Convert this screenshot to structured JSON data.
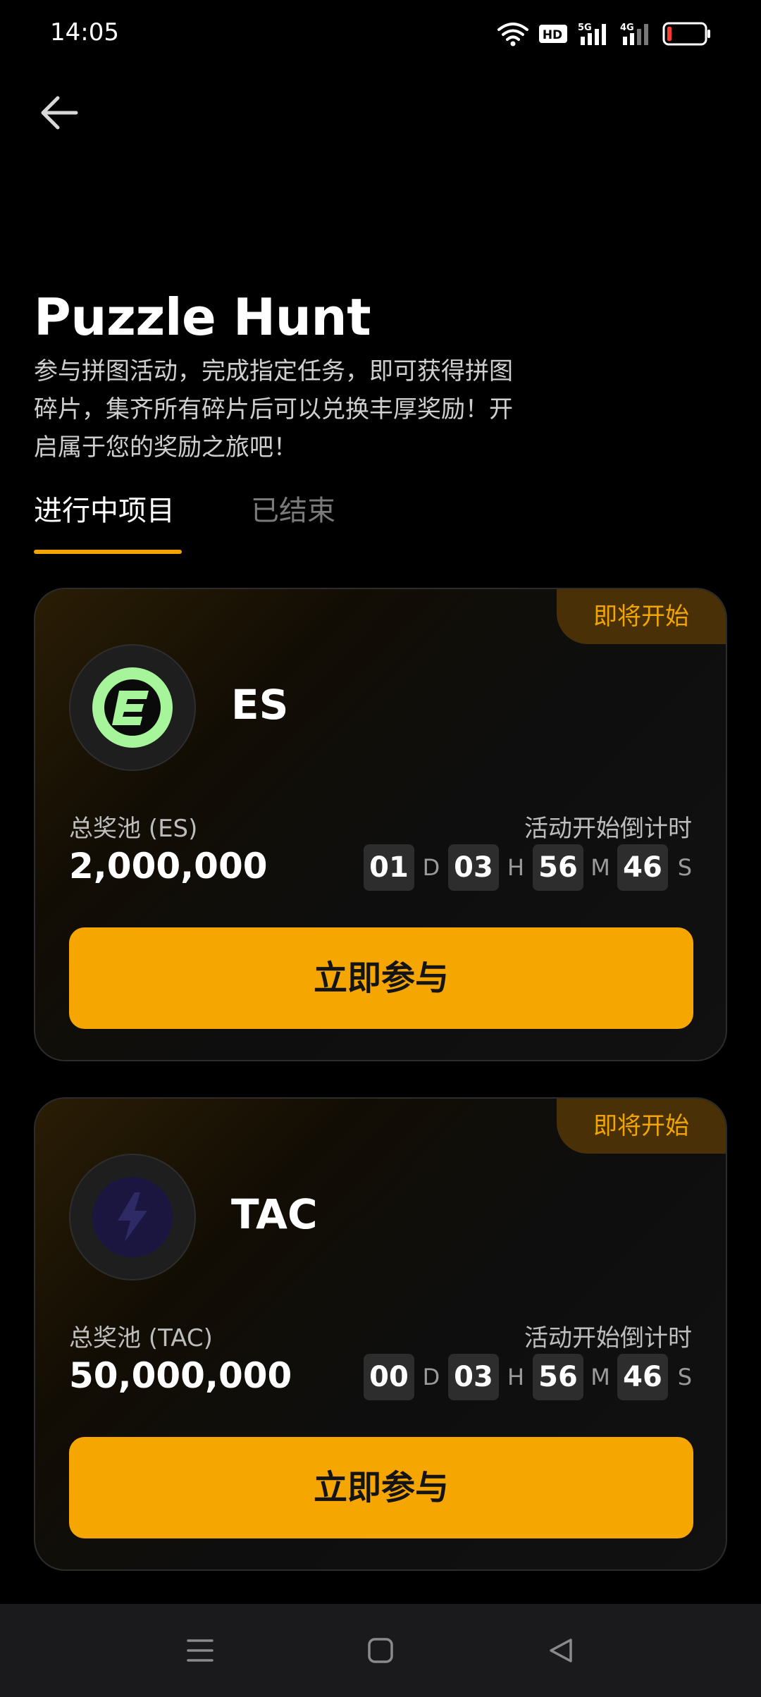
{
  "status_bar": {
    "time": "14:05",
    "icons": [
      "wifi-icon",
      "hd-icon",
      "signal-5g-icon",
      "signal-4g-icon",
      "battery-low-icon"
    ],
    "hd_label": "HD",
    "net1_label": "5G",
    "net2_label": "4G"
  },
  "header": {
    "back_icon": "arrow-left-icon",
    "title": "Puzzle Hunt",
    "description": "参与拼图活动，完成指定任务，即可获得拼图碎片，集齐所有碎片后可以兑换丰厚奖励！开启属于您的奖励之旅吧！"
  },
  "tabs": [
    {
      "label": "进行中项目",
      "active": true
    },
    {
      "label": "已结束",
      "active": false
    }
  ],
  "colors": {
    "accent": "#f5a600",
    "background": "#000000",
    "status_badge_bg": "#4a3006",
    "es_logo": "#a6f59a"
  },
  "cards": [
    {
      "status": "即将开始",
      "token": "ES",
      "logo_icon": "es-token-icon",
      "pool_label": "总奖池 (ES)",
      "pool_value": "2,000,000",
      "countdown_label": "活动开始倒计时",
      "countdown": {
        "days": "01",
        "hours": "03",
        "minutes": "56",
        "seconds": "46"
      },
      "units": {
        "d": "D",
        "h": "H",
        "m": "M",
        "s": "S"
      },
      "button": "立即参与"
    },
    {
      "status": "即将开始",
      "token": "TAC",
      "logo_icon": "tac-token-icon",
      "pool_label": "总奖池 (TAC)",
      "pool_value": "50,000,000",
      "countdown_label": "活动开始倒计时",
      "countdown": {
        "days": "00",
        "hours": "03",
        "minutes": "56",
        "seconds": "46"
      },
      "units": {
        "d": "D",
        "h": "H",
        "m": "M",
        "s": "S"
      },
      "button": "立即参与"
    }
  ],
  "nav_bar": {
    "icons": [
      "menu-icon",
      "home-square-icon",
      "back-triangle-icon"
    ]
  }
}
